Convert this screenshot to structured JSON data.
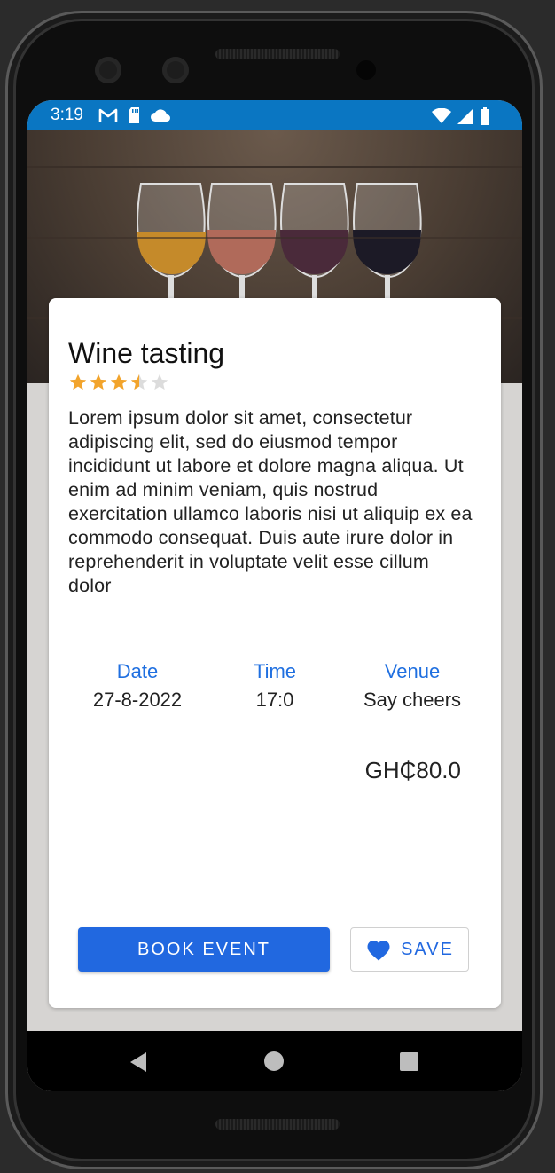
{
  "status_bar": {
    "time": "3:19",
    "icons_left": [
      "gmail-icon",
      "sd-card-icon",
      "cloud-icon"
    ],
    "icons_right": [
      "wifi-icon",
      "signal-icon",
      "battery-icon"
    ],
    "color": "#0a76c2"
  },
  "event": {
    "title": "Wine tasting",
    "rating": 3.5,
    "rating_max": 5,
    "description": "Lorem ipsum dolor sit amet, consectetur adipiscing elit, sed do eiusmod tempor incididunt ut labore et dolore magna aliqua. Ut enim ad minim veniam, quis nostrud exercitation ullamco laboris nisi ut aliquip ex ea commodo consequat. Duis aute irure dolor in reprehenderit in voluptate velit esse cillum dolor",
    "date_label": "Date",
    "date_value": "27-8-2022",
    "time_label": "Time",
    "time_value": "17:0",
    "venue_label": "Venue",
    "venue_value": "Say cheers",
    "price": "GH₵80.0"
  },
  "actions": {
    "book_label": "BOOK EVENT",
    "save_label": "SAVE",
    "accent": "#2168e0"
  },
  "navigation": [
    "back-icon",
    "home-icon",
    "recents-icon"
  ]
}
